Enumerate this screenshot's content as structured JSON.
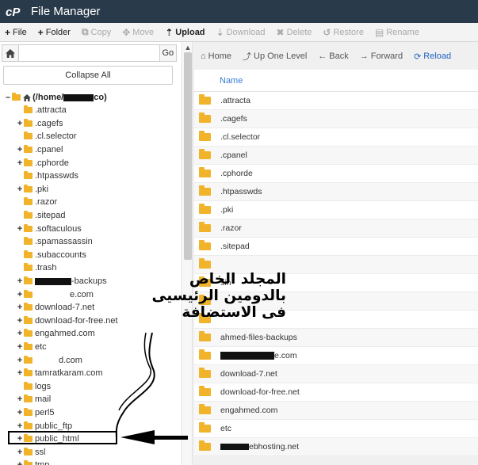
{
  "app": {
    "title": "File Manager"
  },
  "toolbar": {
    "items": [
      {
        "label": "File",
        "icon": "+",
        "enabled": true
      },
      {
        "label": "Folder",
        "icon": "+",
        "enabled": true
      },
      {
        "label": "Copy",
        "icon": "copy-icon",
        "enabled": false
      },
      {
        "label": "Move",
        "icon": "move-icon",
        "enabled": false
      },
      {
        "label": "Upload",
        "icon": "upload-icon",
        "enabled": true
      },
      {
        "label": "Download",
        "icon": "download-icon",
        "enabled": false
      },
      {
        "label": "Delete",
        "icon": "x",
        "enabled": false
      },
      {
        "label": "Restore",
        "icon": "restore-icon",
        "enabled": false
      },
      {
        "label": "Rename",
        "icon": "rename-icon",
        "enabled": false
      }
    ]
  },
  "left": {
    "go_label": "Go",
    "collapse_label": "Collapse All",
    "root_prefix": "(/home/",
    "root_suffix": "co)",
    "tree": [
      {
        "label": ".attracta",
        "exp": ""
      },
      {
        "label": ".cagefs",
        "exp": "+"
      },
      {
        "label": ".cl.selector",
        "exp": ""
      },
      {
        "label": ".cpanel",
        "exp": "+"
      },
      {
        "label": ".cphorde",
        "exp": "+"
      },
      {
        "label": ".htpasswds",
        "exp": ""
      },
      {
        "label": ".pki",
        "exp": "+"
      },
      {
        "label": ".razor",
        "exp": ""
      },
      {
        "label": ".sitepad",
        "exp": ""
      },
      {
        "label": ".softaculous",
        "exp": "+"
      },
      {
        "label": ".spamassassin",
        "exp": ""
      },
      {
        "label": ".subaccounts",
        "exp": ""
      },
      {
        "label": ".trash",
        "exp": ""
      },
      {
        "label": "-backups",
        "exp": "+",
        "redact": 46
      },
      {
        "label": "e.com",
        "exp": "+",
        "redact": 0,
        "blank": 44
      },
      {
        "label": "download-7.net",
        "exp": "+"
      },
      {
        "label": "download-for-free.net",
        "exp": "+"
      },
      {
        "label": "engahmed.com",
        "exp": "+"
      },
      {
        "label": "etc",
        "exp": "+"
      },
      {
        "label": "d.com",
        "exp": "+",
        "blank": 30
      },
      {
        "label": "tamratkaram.com",
        "exp": "+"
      },
      {
        "label": "logs",
        "exp": ""
      },
      {
        "label": "mail",
        "exp": "+"
      },
      {
        "label": "perl5",
        "exp": "+"
      },
      {
        "label": "public_ftp",
        "exp": "+"
      },
      {
        "label": "public_html",
        "exp": "+"
      },
      {
        "label": "ssl",
        "exp": "+"
      },
      {
        "label": "tmp",
        "exp": "+"
      }
    ]
  },
  "right": {
    "nav": {
      "home": "Home",
      "up": "Up One Level",
      "back": "Back",
      "forward": "Forward",
      "reload": "Reload"
    },
    "column_name": "Name",
    "rows": [
      ".attracta",
      ".cagefs",
      ".cl.selector",
      ".cpanel",
      ".cphorde",
      ".htpasswds",
      ".pki",
      ".razor",
      ".sitepad",
      "",
      "sin",
      "",
      "",
      "ahmed-files-backups",
      "e.com",
      "download-7.net",
      "download-for-free.net",
      "engahmed.com",
      "etc",
      "ebhosting.net"
    ]
  },
  "annotation": {
    "arabic_text": "المجلد الخاص بالدومين الرئيسيى فى الاستضافة"
  }
}
